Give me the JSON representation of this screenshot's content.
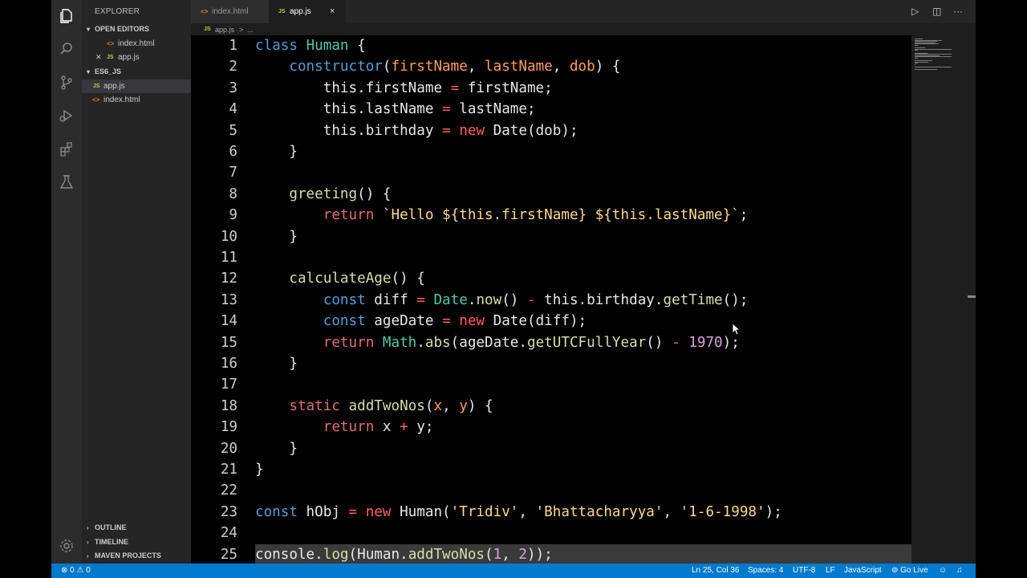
{
  "sidebar": {
    "title": "EXPLORER",
    "open_editors": {
      "title": "OPEN EDITORS",
      "items": [
        {
          "badge": "<>",
          "label": "index.html"
        },
        {
          "badge": "JS",
          "label": "app.js"
        }
      ]
    },
    "folder": {
      "title": "ES6_JS",
      "items": [
        {
          "badge": "JS",
          "label": "app.js"
        },
        {
          "badge": "<>",
          "label": "index.html"
        }
      ]
    },
    "bottom_sections": [
      "OUTLINE",
      "TIMELINE",
      "MAVEN PROJECTS"
    ]
  },
  "tabs": [
    {
      "badge": "<>",
      "label": "index.html",
      "active": false
    },
    {
      "badge": "JS",
      "label": "app.js",
      "active": true,
      "close": "×"
    }
  ],
  "breadcrumb": {
    "badge": "JS",
    "file": "app.js",
    "sep": ">",
    "rest": "..."
  },
  "editor": {
    "current_line": 25,
    "lines": [
      {
        "n": "1",
        "tokens": [
          [
            "k-blue",
            "class"
          ],
          [
            "k-plain",
            " "
          ],
          [
            "k-cls",
            "Human"
          ],
          [
            "k-plain",
            " {"
          ]
        ]
      },
      {
        "n": "2",
        "tokens": [
          [
            "k-plain",
            "    "
          ],
          [
            "k-blue",
            "constructor"
          ],
          [
            "k-plain",
            "("
          ],
          [
            "k-param",
            "firstName"
          ],
          [
            "k-plain",
            ", "
          ],
          [
            "k-param",
            "lastName"
          ],
          [
            "k-plain",
            ", "
          ],
          [
            "k-param",
            "dob"
          ],
          [
            "k-plain",
            ") {"
          ]
        ]
      },
      {
        "n": "3",
        "tokens": [
          [
            "k-plain",
            "        this.firstName "
          ],
          [
            "k-red",
            "="
          ],
          [
            "k-plain",
            " firstName;"
          ]
        ]
      },
      {
        "n": "4",
        "tokens": [
          [
            "k-plain",
            "        this.lastName "
          ],
          [
            "k-red",
            "="
          ],
          [
            "k-plain",
            " lastName;"
          ]
        ]
      },
      {
        "n": "5",
        "tokens": [
          [
            "k-plain",
            "        this.birthday "
          ],
          [
            "k-red",
            "="
          ],
          [
            "k-plain",
            " "
          ],
          [
            "k-red",
            "new"
          ],
          [
            "k-plain",
            " Date(dob);"
          ]
        ]
      },
      {
        "n": "6",
        "tokens": [
          [
            "k-plain",
            "    }"
          ]
        ]
      },
      {
        "n": "7",
        "tokens": []
      },
      {
        "n": "8",
        "tokens": [
          [
            "k-plain",
            "    "
          ],
          [
            "k-fn",
            "greeting"
          ],
          [
            "k-plain",
            "() {"
          ]
        ]
      },
      {
        "n": "9",
        "tokens": [
          [
            "k-plain",
            "        "
          ],
          [
            "k-ctrl",
            "return"
          ],
          [
            "k-plain",
            " "
          ],
          [
            "k-str",
            "`Hello ${this.firstName} ${this.lastName}`"
          ],
          [
            "k-plain",
            ";"
          ]
        ]
      },
      {
        "n": "10",
        "tokens": [
          [
            "k-plain",
            "    }"
          ]
        ]
      },
      {
        "n": "11",
        "tokens": []
      },
      {
        "n": "12",
        "tokens": [
          [
            "k-plain",
            "    "
          ],
          [
            "k-fn",
            "calculateAge"
          ],
          [
            "k-plain",
            "() {"
          ]
        ]
      },
      {
        "n": "13",
        "tokens": [
          [
            "k-plain",
            "        "
          ],
          [
            "k-blue",
            "const"
          ],
          [
            "k-plain",
            " diff "
          ],
          [
            "k-red",
            "="
          ],
          [
            "k-plain",
            " "
          ],
          [
            "k-cls",
            "Date"
          ],
          [
            "k-plain",
            "."
          ],
          [
            "k-fn",
            "now"
          ],
          [
            "k-plain",
            "() "
          ],
          [
            "k-red",
            "-"
          ],
          [
            "k-plain",
            " this.birthday."
          ],
          [
            "k-fn",
            "getTime"
          ],
          [
            "k-plain",
            "();"
          ]
        ]
      },
      {
        "n": "14",
        "tokens": [
          [
            "k-plain",
            "        "
          ],
          [
            "k-blue",
            "const"
          ],
          [
            "k-plain",
            " ageDate "
          ],
          [
            "k-red",
            "="
          ],
          [
            "k-plain",
            " "
          ],
          [
            "k-red",
            "new"
          ],
          [
            "k-plain",
            " Date(diff);"
          ]
        ]
      },
      {
        "n": "15",
        "tokens": [
          [
            "k-plain",
            "        "
          ],
          [
            "k-ctrl",
            "return"
          ],
          [
            "k-plain",
            " "
          ],
          [
            "k-cls",
            "Math"
          ],
          [
            "k-plain",
            "."
          ],
          [
            "k-fn",
            "abs"
          ],
          [
            "k-plain",
            "(ageDate."
          ],
          [
            "k-fn",
            "getUTCFullYear"
          ],
          [
            "k-plain",
            "() "
          ],
          [
            "k-red",
            "-"
          ],
          [
            "k-plain",
            " "
          ],
          [
            "k-num",
            "1970"
          ],
          [
            "k-plain",
            ");"
          ]
        ]
      },
      {
        "n": "16",
        "tokens": [
          [
            "k-plain",
            "    }"
          ]
        ]
      },
      {
        "n": "17",
        "tokens": []
      },
      {
        "n": "18",
        "tokens": [
          [
            "k-plain",
            "    "
          ],
          [
            "k-ctrl",
            "static"
          ],
          [
            "k-plain",
            " "
          ],
          [
            "k-fn",
            "addTwoNos"
          ],
          [
            "k-plain",
            "("
          ],
          [
            "k-param",
            "x"
          ],
          [
            "k-plain",
            ", "
          ],
          [
            "k-param",
            "y"
          ],
          [
            "k-plain",
            ") {"
          ]
        ]
      },
      {
        "n": "19",
        "tokens": [
          [
            "k-plain",
            "        "
          ],
          [
            "k-ctrl",
            "return"
          ],
          [
            "k-plain",
            " x "
          ],
          [
            "k-red",
            "+"
          ],
          [
            "k-plain",
            " y;"
          ]
        ]
      },
      {
        "n": "20",
        "tokens": [
          [
            "k-plain",
            "    }"
          ]
        ]
      },
      {
        "n": "21",
        "tokens": [
          [
            "k-plain",
            "}"
          ]
        ]
      },
      {
        "n": "22",
        "tokens": []
      },
      {
        "n": "23",
        "tokens": [
          [
            "k-blue",
            "const"
          ],
          [
            "k-plain",
            " hObj "
          ],
          [
            "k-red",
            "="
          ],
          [
            "k-plain",
            " "
          ],
          [
            "k-red",
            "new"
          ],
          [
            "k-plain",
            " Human("
          ],
          [
            "k-str",
            "'Tridiv'"
          ],
          [
            "k-plain",
            ", "
          ],
          [
            "k-str",
            "'Bhattacharyya'"
          ],
          [
            "k-plain",
            ", "
          ],
          [
            "k-str",
            "'1-6-1998'"
          ],
          [
            "k-plain",
            ");"
          ]
        ]
      },
      {
        "n": "24",
        "tokens": []
      },
      {
        "n": "25",
        "tokens": [
          [
            "k-plain",
            "console."
          ],
          [
            "k-fn",
            "log"
          ],
          [
            "k-plain",
            "(Human."
          ],
          [
            "k-fn",
            "addTwoNos"
          ],
          [
            "k-plain",
            "("
          ],
          [
            "k-num",
            "1"
          ],
          [
            "k-plain",
            ", "
          ],
          [
            "k-num",
            "2"
          ],
          [
            "k-plain",
            "));"
          ]
        ]
      }
    ]
  },
  "status": {
    "errors": "0",
    "warnings": "0",
    "position": "Ln 25, Col 36",
    "spaces": "Spaces: 4",
    "encoding": "UTF-8",
    "eol": "LF",
    "language": "JavaScript",
    "live": "Go Live"
  },
  "colors": {
    "statusbar": "#007acc",
    "editor_bg": "#000000",
    "sidebar_bg": "#252526",
    "activity_bg": "#2c2c2c"
  }
}
